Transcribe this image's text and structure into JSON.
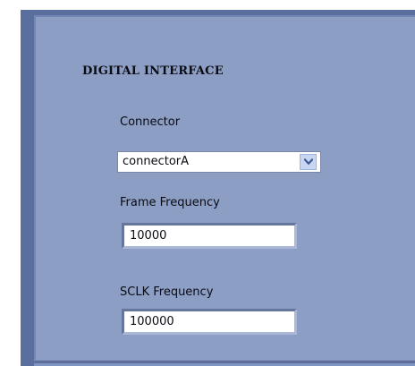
{
  "section": {
    "title": "DIGITAL INTERFACE"
  },
  "connector": {
    "label": "Connector",
    "selected": "connectorA"
  },
  "frame_frequency": {
    "label": "Frame Frequency",
    "value": "10000"
  },
  "sclk_frequency": {
    "label": "SCLK Frequency",
    "value": "100000"
  },
  "icons": {
    "dropdown": "chevron-down-icon"
  },
  "colors": {
    "panel": "#8c9ec4",
    "panel_outer": "#5b6f9e",
    "input_bg": "#ffffff",
    "dropdown_button": "#c9d6f2"
  }
}
